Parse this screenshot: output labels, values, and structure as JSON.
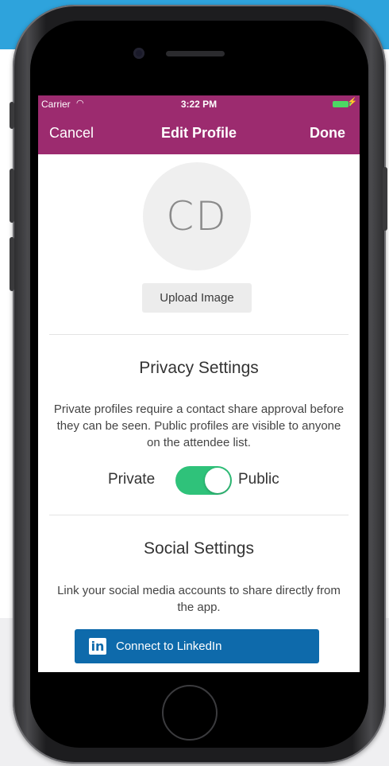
{
  "status_bar": {
    "carrier": "Carrier",
    "wifi_icon": "◠",
    "time": "3:22 PM",
    "bolt_icon": "⚡"
  },
  "nav": {
    "cancel_label": "Cancel",
    "title": "Edit Profile",
    "done_label": "Done"
  },
  "profile": {
    "avatar_initials": "CD",
    "upload_label": "Upload Image"
  },
  "privacy": {
    "title": "Privacy Settings",
    "description": "Private profiles require a contact share approval before they can be seen. Public profiles are visible to anyone on the attendee list.",
    "private_label": "Private",
    "public_label": "Public",
    "toggle_state": "Public"
  },
  "social": {
    "title": "Social Settings",
    "description": "Link your social media accounts to share directly from the app.",
    "linkedin_logo": "in",
    "linkedin_label": "Connect to LinkedIn"
  },
  "colors": {
    "nav_bar": "#9c2b6f",
    "toggle_on": "#2fc27a",
    "linkedin": "#0e6aab",
    "battery": "#4cd964",
    "page_top_band": "#2ea3dc"
  }
}
